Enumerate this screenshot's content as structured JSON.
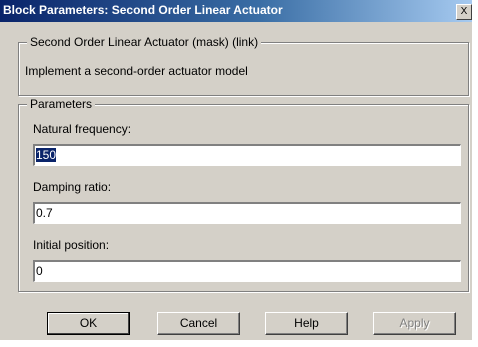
{
  "window": {
    "title": "Block Parameters: Second Order Linear Actuator",
    "close_label": "X"
  },
  "mask": {
    "legend": "Second Order Linear Actuator (mask) (link)",
    "description": "Implement a second-order actuator model"
  },
  "parameters": {
    "legend": "Parameters",
    "fields": [
      {
        "label": "Natural frequency:",
        "value": "150"
      },
      {
        "label": "Damping ratio:",
        "value": "0.7"
      },
      {
        "label": "Initial position:",
        "value": "0"
      }
    ]
  },
  "buttons": {
    "ok": "OK",
    "cancel": "Cancel",
    "help": "Help",
    "apply": "Apply"
  }
}
